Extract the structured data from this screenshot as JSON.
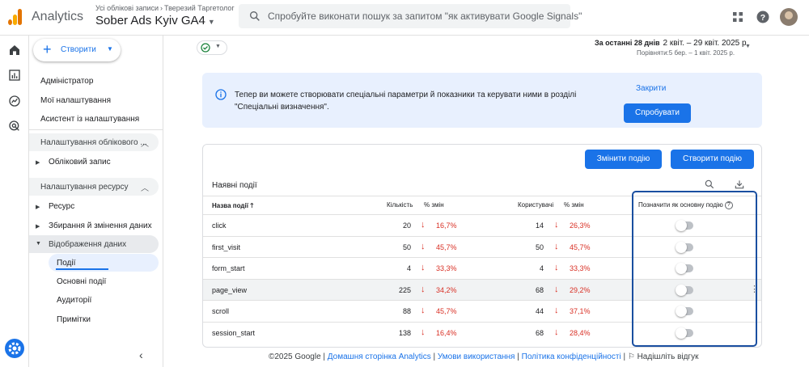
{
  "topbar": {
    "app_name": "Analytics",
    "breadcrumb_account": "Усі облікові записи",
    "breadcrumb_sub": "Тверезий Таргетолог",
    "property_name": "Sober Ads Kyiv GA4",
    "search_placeholder": "Спробуйте виконати пошук за запитом \"як активувати Google Signals\""
  },
  "rail": {
    "icons": [
      "home-icon",
      "reports-icon",
      "explore-icon",
      "advertising-icon",
      "admin-gear-icon"
    ]
  },
  "panel": {
    "create_label": "Створити",
    "top_items": [
      "Адміністратор",
      "Мої налаштування",
      "Асистент із налаштування"
    ],
    "account_section": "Налаштування облікового ...",
    "account_item": "Обліковий запис",
    "property_section": "Налаштування ресурсу",
    "property_items": [
      "Ресурс",
      "Збирання й змінення даних",
      "Відображення даних"
    ],
    "data_display_sub": [
      "Події",
      "Основні події",
      "Аудиторії",
      "Примітки"
    ]
  },
  "daterange": {
    "label": "За останні 28 днів",
    "range": "2 квіт. – 29 квіт. 2025 р.",
    "compare": "Порівняти:5 бер. – 1 квіт. 2025 р."
  },
  "banner": {
    "message": "Тепер ви можете створювати спеціальні параметри й показники та керувати ними в розділі \"Спеціальні визначення\".",
    "close_label": "Закрити",
    "try_label": "Спробувати"
  },
  "events_card": {
    "modify_label": "Змінити подію",
    "create_label": "Створити подію",
    "title": "Наявні події",
    "columns": {
      "name": "Назва події",
      "count": "Кількість",
      "count_change": "% змін",
      "users": "Користувачі",
      "users_change": "% змін",
      "mark_key": "Позначити як основну подію"
    },
    "rows": [
      {
        "name": "click",
        "count": "20",
        "count_change": "16,7%",
        "users": "14",
        "users_change": "26,3%",
        "key_event": false
      },
      {
        "name": "first_visit",
        "count": "50",
        "count_change": "45,7%",
        "users": "50",
        "users_change": "45,7%",
        "key_event": false
      },
      {
        "name": "form_start",
        "count": "4",
        "count_change": "33,3%",
        "users": "4",
        "users_change": "33,3%",
        "key_event": false
      },
      {
        "name": "page_view",
        "count": "225",
        "count_change": "34,2%",
        "users": "68",
        "users_change": "29,2%",
        "key_event": false
      },
      {
        "name": "scroll",
        "count": "88",
        "count_change": "45,7%",
        "users": "44",
        "users_change": "37,1%",
        "key_event": false
      },
      {
        "name": "session_start",
        "count": "138",
        "count_change": "16,4%",
        "users": "68",
        "users_change": "28,4%",
        "key_event": false
      }
    ]
  },
  "footer": {
    "copyright": "©2025 Google",
    "home_link": "Домашня сторінка Analytics",
    "terms_link": "Умови використання",
    "privacy_link": "Політика конфіденційності",
    "feedback": "Надішліть відгук"
  },
  "colors": {
    "accent": "#1a73e8",
    "negative": "#d93025",
    "highlight_box": "#1a4fa0"
  }
}
